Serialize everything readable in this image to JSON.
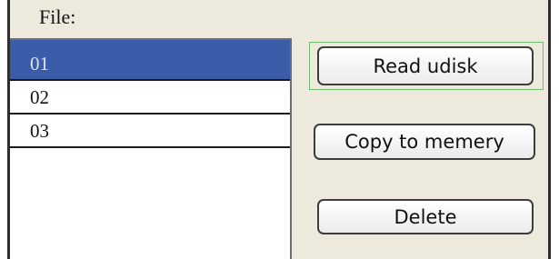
{
  "header": {
    "file_label": "File:"
  },
  "file_list": {
    "items": [
      {
        "label": "01",
        "selected": true
      },
      {
        "label": "02",
        "selected": false
      },
      {
        "label": "03",
        "selected": false
      }
    ]
  },
  "buttons": {
    "read_udisk": "Read udisk",
    "copy_to_memory": "Copy to memery",
    "delete": "Delete"
  },
  "colors": {
    "selection": "#3b5ca8",
    "panel_background": "#ede9dc",
    "focus_outline": "#6dbb6d"
  }
}
